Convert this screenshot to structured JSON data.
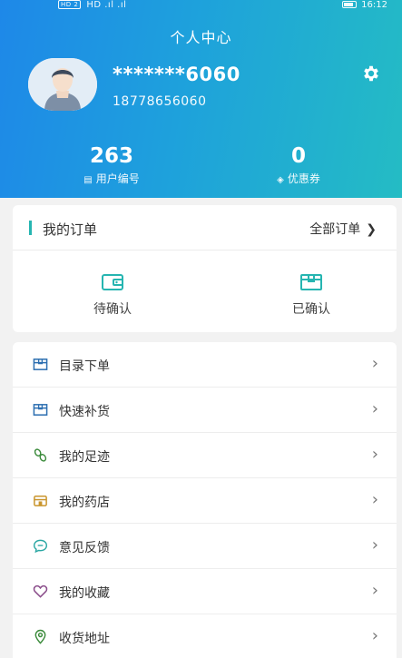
{
  "status_bar": {
    "left_text": "HD  .ıl  .ıl",
    "right_text": "16:12",
    "badge": "HD 2"
  },
  "header": {
    "title": "个人中心",
    "user_name": "*******6060",
    "user_phone": "18778656060",
    "stats": [
      {
        "value": "263",
        "label": "用户编号",
        "icon": "id-card-icon"
      },
      {
        "value": "0",
        "label": "优惠券",
        "icon": "coupon-icon"
      }
    ]
  },
  "orders": {
    "title": "我的订单",
    "all_label": "全部订单",
    "items": [
      {
        "label": "待确认",
        "icon": "wallet-icon"
      },
      {
        "label": "已确认",
        "icon": "package-icon"
      }
    ]
  },
  "menu": {
    "items": [
      {
        "label": "目录下单",
        "icon": "catalog-icon"
      },
      {
        "label": "快速补货",
        "icon": "restock-icon"
      },
      {
        "label": "我的足迹",
        "icon": "footprint-icon"
      },
      {
        "label": "我的药店",
        "icon": "store-icon"
      },
      {
        "label": "意见反馈",
        "icon": "feedback-icon"
      },
      {
        "label": "我的收藏",
        "icon": "heart-icon"
      },
      {
        "label": "收货地址",
        "icon": "location-icon"
      }
    ]
  },
  "colors": {
    "accent": "#26b5b1",
    "header_start": "#1e88e8",
    "header_end": "#24bcc4"
  }
}
